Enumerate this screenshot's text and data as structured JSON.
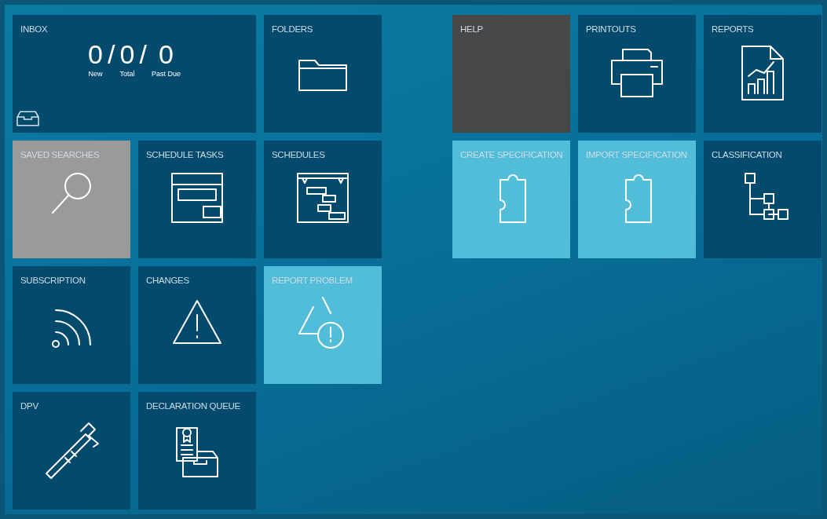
{
  "inbox": {
    "label": "INBOX",
    "separator": "/",
    "counts": [
      {
        "value": "0",
        "label": "New"
      },
      {
        "value": "0",
        "label": "Total"
      },
      {
        "value": "0",
        "label": "Past Due"
      }
    ]
  },
  "left_tiles": [
    {
      "label": "FOLDERS",
      "color": "#044a6c"
    },
    {
      "label": "SAVED SEARCHES",
      "color": "#9a9a9a"
    },
    {
      "label": "SCHEDULE TASKS",
      "color": "#044a6c"
    },
    {
      "label": "SCHEDULES",
      "color": "#044a6c"
    },
    {
      "label": "SUBSCRIPTION",
      "color": "#044a6c"
    },
    {
      "label": "CHANGES",
      "color": "#044a6c"
    },
    {
      "label": "REPORT PROBLEM",
      "color": "#52bdd8"
    },
    {
      "label": "DPV",
      "color": "#044a6c"
    },
    {
      "label": "DECLARATION QUEUE",
      "color": "#044a6c"
    }
  ],
  "right_tiles": [
    {
      "label": "HELP",
      "color": "#474747"
    },
    {
      "label": "PRINTOUTS",
      "color": "#044a6c"
    },
    {
      "label": "REPORTS",
      "color": "#044a6c"
    },
    {
      "label": "CREATE SPECIFICATION",
      "color": "#52bdd8"
    },
    {
      "label": "IMPORT SPECIFICATION",
      "color": "#52bdd8"
    },
    {
      "label": "CLASSIFICATION",
      "color": "#044a6c"
    }
  ]
}
